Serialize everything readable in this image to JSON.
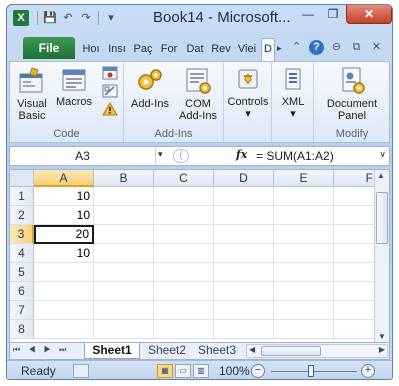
{
  "window": {
    "title": "Book14 - Microsoft...",
    "min_glyph": "—",
    "max_glyph": "❐",
    "close_glyph": "✕"
  },
  "qat": {
    "save_glyph": "💾",
    "undo_glyph": "↶",
    "redo_glyph": "↷",
    "customize_glyph": "▾"
  },
  "tabs": {
    "file": "File",
    "items": [
      "Hoı",
      "Insı",
      "Paç",
      "For",
      "Dat",
      "Rev",
      "Viei",
      "D"
    ],
    "more_arrow": "▸",
    "icons": {
      "minimize_ribbon": "⌃",
      "help": "?",
      "restore": "⊖",
      "window": "⧉",
      "close": "✕"
    }
  },
  "ribbon": {
    "groups": [
      {
        "label": "Code",
        "buttons": [
          "Visual Basic",
          "Macros"
        ]
      },
      {
        "label": "Add-Ins",
        "buttons": [
          "Add-Ins",
          "COM Add-Ins"
        ]
      },
      {
        "label": "",
        "buttons": [
          "Controls"
        ]
      },
      {
        "label": "",
        "buttons": [
          "XML"
        ]
      },
      {
        "label": "Modify",
        "buttons": [
          "Document Panel"
        ]
      }
    ],
    "labels": {
      "visual_basic_1": "Visual",
      "visual_basic_2": "Basic",
      "macros": "Macros",
      "addins": "Add-Ins",
      "com_1": "COM",
      "com_2": "Add-Ins",
      "controls": "Controls",
      "xml": "XML",
      "docpanel_1": "Document",
      "docpanel_2": "Panel",
      "dropdown": "▾"
    }
  },
  "formula_bar": {
    "name_box": "A3",
    "fx_label": "fx",
    "formula": "= SUM(A1:A2)"
  },
  "grid": {
    "columns": [
      "A",
      "B",
      "C",
      "D",
      "E",
      "F"
    ],
    "selected_column": "A",
    "rows": [
      "1",
      "2",
      "3",
      "4",
      "5",
      "6",
      "7",
      "8"
    ],
    "selected_row": "3",
    "active_cell": "A3",
    "values": {
      "A1": "10",
      "A2": "10",
      "A3": "20",
      "A4": "10"
    }
  },
  "sheets": {
    "nav": "⏮ ◀ ▶ ⏭",
    "tabs": [
      "Sheet1",
      "Sheet2",
      "Sheet3"
    ],
    "active": "Sheet1"
  },
  "status": {
    "ready": "Ready",
    "zoom": "100%",
    "zoom_minus": "−",
    "zoom_plus": "+"
  },
  "colors": {
    "title_bar": "#c9dcf3",
    "file_tab": "#2a8446",
    "close_button": "#d05a45",
    "selected_header": "#f8cf76"
  }
}
